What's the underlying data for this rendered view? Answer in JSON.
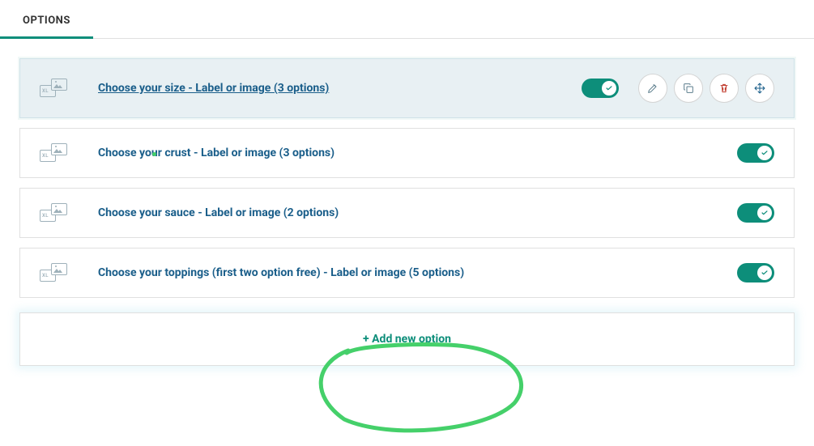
{
  "tab": "OPTIONS",
  "options": [
    {
      "label": "Choose your size - Label or image (3 options)",
      "active": true
    },
    {
      "label": "Choose your crust - Label or image (3 options)",
      "active": false
    },
    {
      "label": "Choose your sauce - Label or image (2 options)",
      "active": false
    },
    {
      "label": "Choose your toppings (first two option free) - Label or image (5 options)",
      "active": false
    }
  ],
  "add_label": "+ Add new option"
}
